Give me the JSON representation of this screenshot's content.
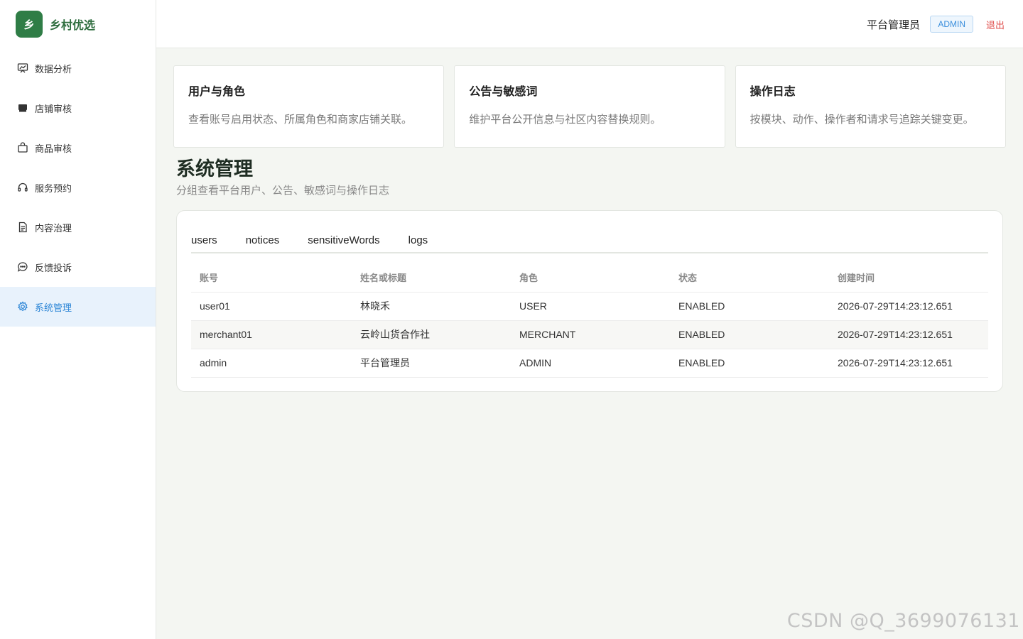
{
  "brand": {
    "logo_char": "乡",
    "name": "乡村优选"
  },
  "sidebar": {
    "items": [
      {
        "label": "数据分析",
        "icon": "chart-icon"
      },
      {
        "label": "店铺审核",
        "icon": "store-icon"
      },
      {
        "label": "商品审核",
        "icon": "bag-icon"
      },
      {
        "label": "服务预约",
        "icon": "headset-icon"
      },
      {
        "label": "内容治理",
        "icon": "document-icon"
      },
      {
        "label": "反馈投诉",
        "icon": "chat-icon"
      },
      {
        "label": "系统管理",
        "icon": "gear-icon",
        "active": true
      }
    ]
  },
  "header": {
    "user_name": "平台管理员",
    "role": "ADMIN",
    "logout": "退出"
  },
  "cards": [
    {
      "title": "用户与角色",
      "desc": "查看账号启用状态、所属角色和商家店铺关联。"
    },
    {
      "title": "公告与敏感词",
      "desc": "维护平台公开信息与社区内容替换规则。"
    },
    {
      "title": "操作日志",
      "desc": "按模块、动作、操作者和请求号追踪关键变更。"
    }
  ],
  "page": {
    "title": "系统管理",
    "subtitle": "分组查看平台用户、公告、敏感词与操作日志"
  },
  "tabs": [
    "users",
    "notices",
    "sensitiveWords",
    "logs"
  ],
  "table": {
    "columns": [
      "账号",
      "姓名或标题",
      "角色",
      "状态",
      "创建时间"
    ],
    "rows": [
      [
        "user01",
        "林晓禾",
        "USER",
        "ENABLED",
        "2026-07-29T14:23:12.651"
      ],
      [
        "merchant01",
        "云岭山货合作社",
        "MERCHANT",
        "ENABLED",
        "2026-07-29T14:23:12.651"
      ],
      [
        "admin",
        "平台管理员",
        "ADMIN",
        "ENABLED",
        "2026-07-29T14:23:12.651"
      ]
    ]
  },
  "watermark": "CSDN @Q_3699076131",
  "colors": {
    "brand": "#2f7d46",
    "accent": "#2d86d6",
    "danger": "#e0504e",
    "active_bg": "#e8f2fc"
  }
}
